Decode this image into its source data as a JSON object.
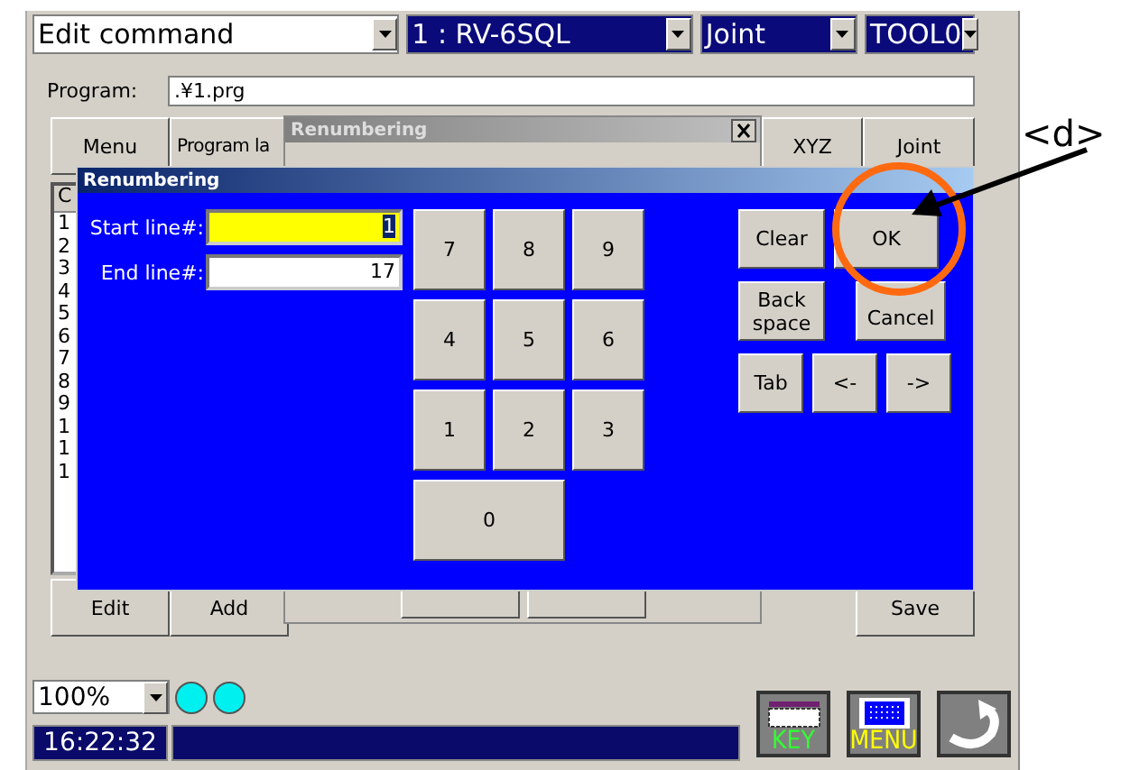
{
  "top_bar": {
    "mode": "Edit command",
    "robot": "1 : RV-6SQL",
    "frame": "Joint",
    "tool": "TOOL0"
  },
  "program": {
    "label": "Program:",
    "value": ".¥1.prg"
  },
  "top_buttons": {
    "left": [
      "Menu",
      "Program la"
    ],
    "right": [
      "XYZ",
      "Joint"
    ]
  },
  "line_list": {
    "header": "C",
    "lines": [
      "1",
      "2",
      "3",
      "4",
      "5",
      "6",
      "7",
      "8",
      "9",
      "1",
      "1",
      "1"
    ]
  },
  "bottom_buttons": {
    "left": [
      "Edit",
      "Add"
    ],
    "right": [
      "Save"
    ]
  },
  "zoom": "100%",
  "clock": "16:22:32",
  "taskbar": [
    {
      "kind": "keyboard",
      "label": "KEY"
    },
    {
      "kind": "menu",
      "label": "MENU"
    },
    {
      "kind": "back"
    }
  ],
  "background_dialog": {
    "title": "Renumbering"
  },
  "dialog": {
    "title": "Renumbering",
    "fields": [
      {
        "label": "Start line#:",
        "value": "1",
        "focused": true
      },
      {
        "label": "End line#:",
        "value": "17",
        "focused": false
      }
    ],
    "keypad": [
      "7",
      "8",
      "9",
      "4",
      "5",
      "6",
      "1",
      "2",
      "3",
      "0"
    ],
    "action_rows": [
      [
        "Clear",
        "OK"
      ],
      [
        "Back space",
        "Cancel"
      ],
      [
        "Tab",
        "<-",
        "->"
      ]
    ]
  },
  "annotation": {
    "label": "<d>"
  }
}
